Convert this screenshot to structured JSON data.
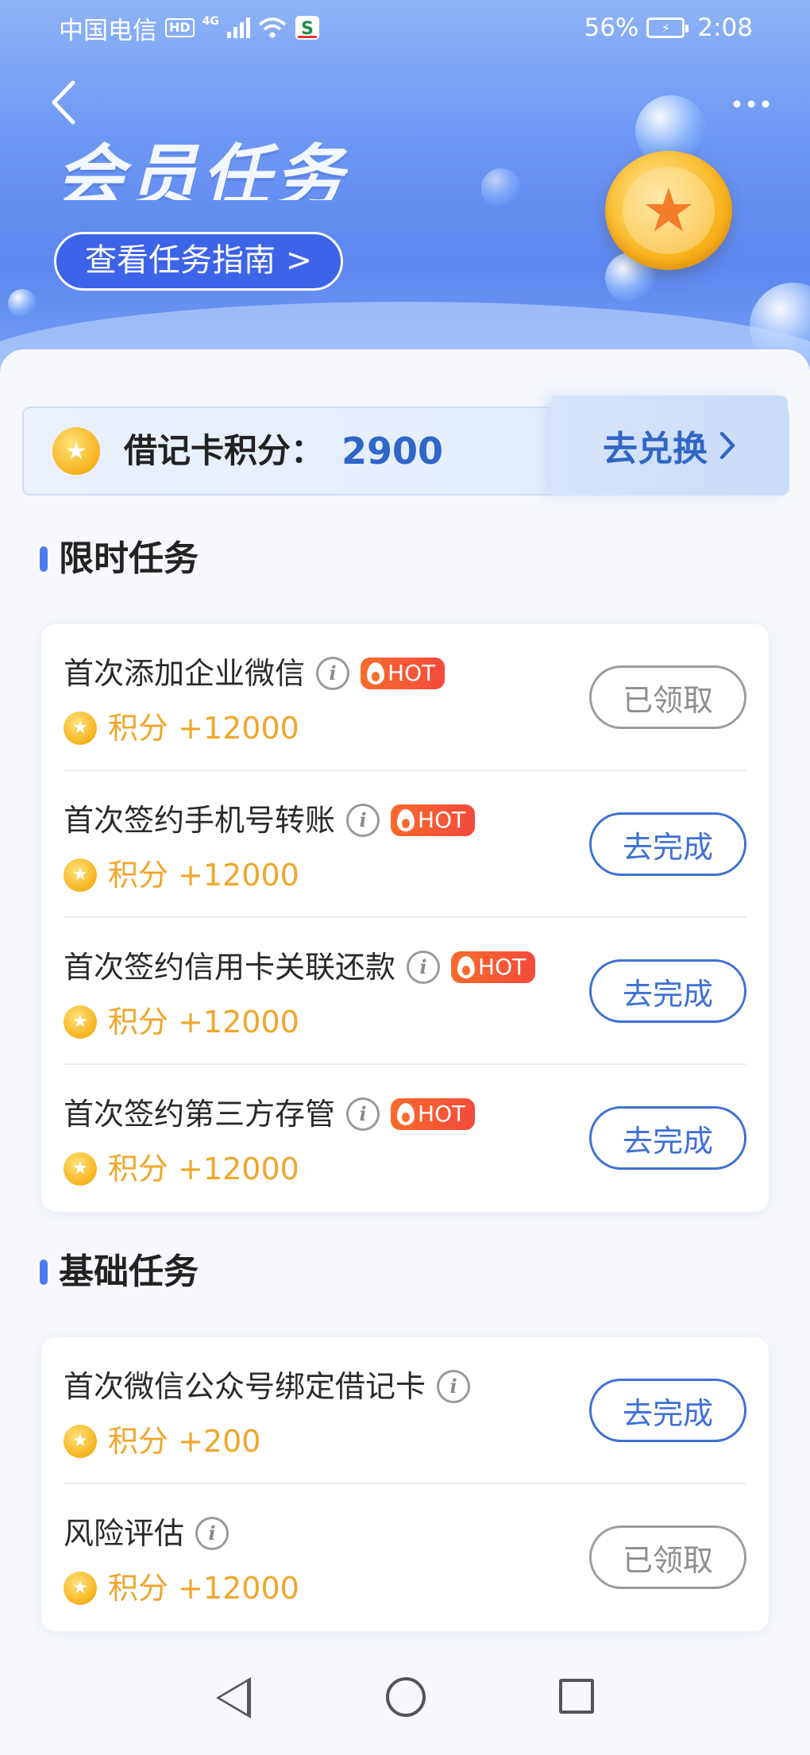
{
  "status_bar": {
    "carrier": "中国电信",
    "hd_tag": "HD",
    "network": "4G",
    "battery_percent": "56%",
    "time": "2:08"
  },
  "header": {
    "back_icon": "chevron-left-icon",
    "more_icon": "more-horizontal-icon",
    "title": "会员任务",
    "guide_button": "查看任务指南 >"
  },
  "points": {
    "label": "借记卡积分：",
    "value": "2900",
    "redeem_label": "去兑换",
    "redeem_icon": "chevron-right-icon"
  },
  "sections": [
    {
      "title": "限时任务",
      "tasks": [
        {
          "title": "首次添加企业微信",
          "hot": true,
          "reward": "积分 +12000",
          "action": "已领取",
          "status": "done"
        },
        {
          "title": "首次签约手机号转账",
          "hot": true,
          "reward": "积分 +12000",
          "action": "去完成",
          "status": "go"
        },
        {
          "title": "首次签约信用卡关联还款",
          "hot": true,
          "reward": "积分 +12000",
          "action": "去完成",
          "status": "go"
        },
        {
          "title": "首次签约第三方存管",
          "hot": true,
          "reward": "积分 +12000",
          "action": "去完成",
          "status": "go"
        }
      ]
    },
    {
      "title": "基础任务",
      "tasks": [
        {
          "title": "首次微信公众号绑定借记卡",
          "hot": false,
          "reward": "积分 +200",
          "action": "去完成",
          "status": "go"
        },
        {
          "title": "风险评估",
          "hot": false,
          "reward": "积分 +12000",
          "action": "已领取",
          "status": "done"
        }
      ]
    }
  ],
  "hot_label": "HOT",
  "colors": {
    "accent_blue": "#3f70d6",
    "points_blue": "#2f66c8",
    "reward_gold": "#f0a62a",
    "hot_orange": "#f76b2b",
    "done_gray": "#8e8e8e"
  },
  "nav": {
    "back_icon": "triangle-back-icon",
    "home_icon": "circle-home-icon",
    "recent_icon": "square-recent-icon"
  }
}
